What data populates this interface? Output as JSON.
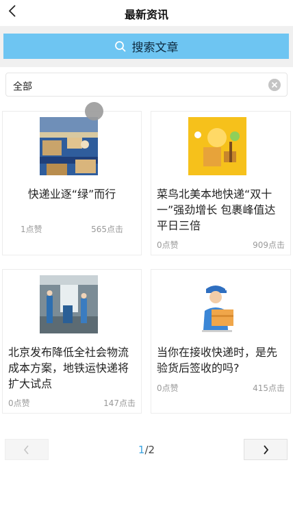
{
  "header": {
    "title": "最新资讯"
  },
  "search": {
    "button_label": "搜索文章"
  },
  "filter": {
    "value": "全部"
  },
  "articles": [
    {
      "title": "快递业逐“绿”而行",
      "likes": "1点赞",
      "clicks": "565点击"
    },
    {
      "title": "菜鸟北美本地快递“双十一”强劲增长 包裹峰值达平日三倍",
      "likes": "0点赞",
      "clicks": "909点击"
    },
    {
      "title": "北京发布降低全社会物流成本方案，地铁运快递将扩大试点",
      "likes": "0点赞",
      "clicks": "147点击"
    },
    {
      "title": "当你在接收快递时，是先验货后签收的吗?",
      "likes": "0点赞",
      "clicks": "415点击"
    }
  ],
  "pagination": {
    "current": "1",
    "total": "/2"
  },
  "colors": {
    "accent": "#6ec5f2",
    "page_active": "#3aa3e0"
  },
  "icons": {
    "back": "chevron-left-icon",
    "search": "search-icon",
    "clear": "clear-circle-icon",
    "prev": "chevron-left-icon",
    "next": "chevron-right-icon"
  }
}
